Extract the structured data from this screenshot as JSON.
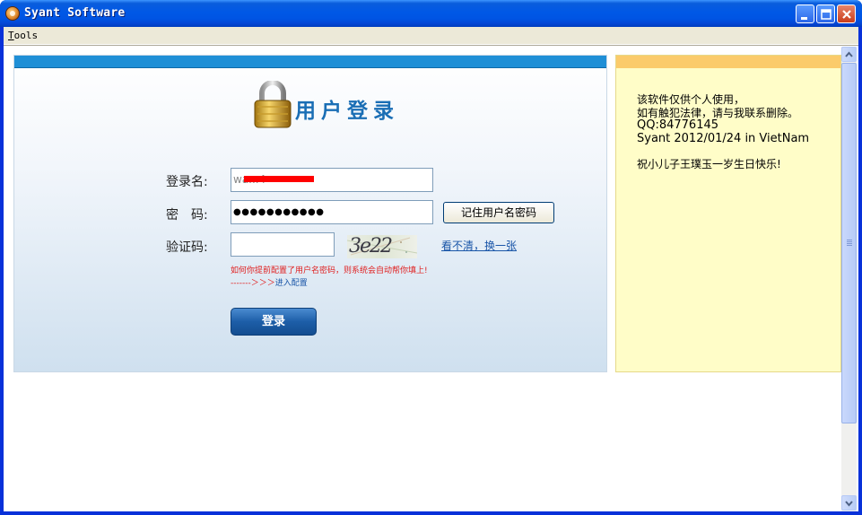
{
  "window": {
    "title": "Syant Software"
  },
  "menu": {
    "tools_accel": "T",
    "tools_rest": "ools"
  },
  "login": {
    "title": "用户登录",
    "username_label": "登录名:",
    "username_value": "wa...4",
    "password_label": "密　码:",
    "password_value": "●●●●●●●●●●●",
    "remember_button": "记住用户名密码",
    "captcha_label": "验证码:",
    "captcha_value": "",
    "captcha_text": "3e22",
    "refresh_link": "看不清，换一张",
    "hint_line1": "如何你提前配置了用户名密码，则系统会自动帮你填上!",
    "hint_line2_prefix": "-------＞＞＞",
    "hint_line2_link": "进入配置",
    "login_button": "登录"
  },
  "info": {
    "lines": [
      "该软件仅供个人使用，",
      "如有触犯法律，请与我联系删除。",
      "QQ:84776145",
      "Syant 2012/01/24 in VietNam",
      "",
      "祝小儿子王璞玉一岁生日快乐!"
    ]
  },
  "colors": {
    "login_topbar": "#1f8fd6",
    "info_topbar": "#fbcb6b",
    "info_bg": "#fffdc8",
    "title_blue": "#1a6eb5"
  }
}
